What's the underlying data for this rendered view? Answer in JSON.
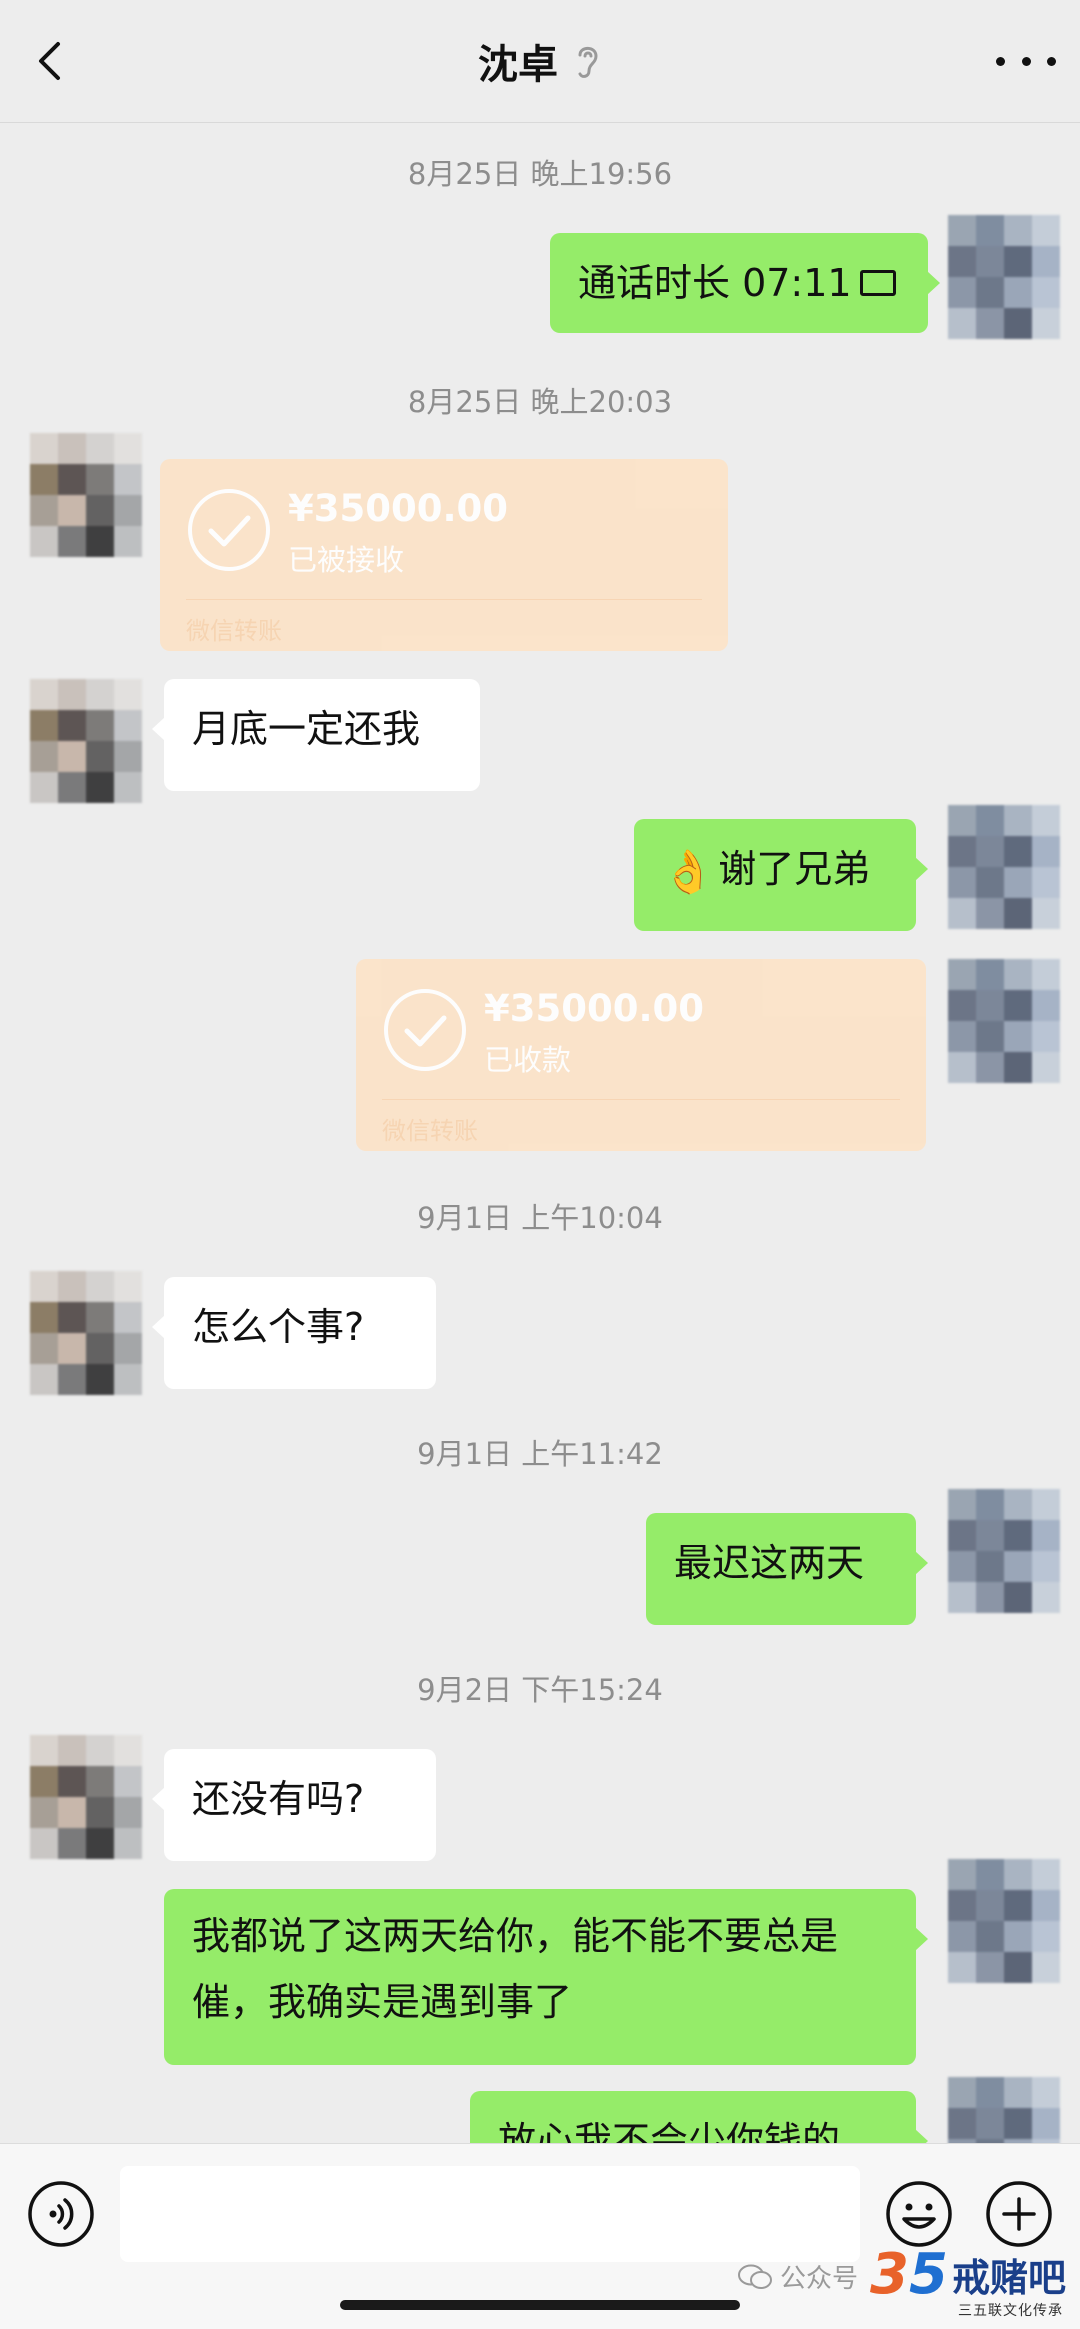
{
  "header": {
    "title": "沈卓",
    "back_icon": "chevron-left-icon",
    "ear_icon": "ear-icon",
    "more_icon": "more-dots-icon"
  },
  "messages": {
    "ts1": "8月25日 晚上19:56",
    "call": {
      "text": "通话时长 07:11",
      "icon": "video-call-icon"
    },
    "ts2": "8月25日 晚上20:03",
    "transfer1": {
      "amount": "¥35000.00",
      "status": "已被接收",
      "brand": "微信转账"
    },
    "m1": "月底一定还我",
    "m2": {
      "emoji": "👌",
      "text": "谢了兄弟"
    },
    "transfer2": {
      "amount": "¥35000.00",
      "status": "已收款",
      "brand": "微信转账"
    },
    "ts3": "9月1日 上午10:04",
    "m3": "怎么个事?",
    "ts4": "9月1日 上午11:42",
    "m4": "最迟这两天",
    "ts5": "9月2日 下午15:24",
    "m5": "还没有吗?",
    "m6": "我都说了这两天给你，能不能不要总是催，我确实是遇到事了",
    "m7": "放心我不会少你钱的"
  },
  "input": {
    "placeholder": "",
    "voice_icon": "voice-icon",
    "emoji_icon": "emoji-icon",
    "plus_icon": "plus-icon"
  },
  "watermark": {
    "source": "公众号",
    "num_a": "3",
    "num_b": "5",
    "name": "戒赌吧",
    "sub": "三五联文化传承"
  },
  "colors": {
    "bg": "#ededed",
    "my_bubble": "#95ec69",
    "peer_bubble": "#ffffff",
    "transfer": "#fce3c8"
  }
}
